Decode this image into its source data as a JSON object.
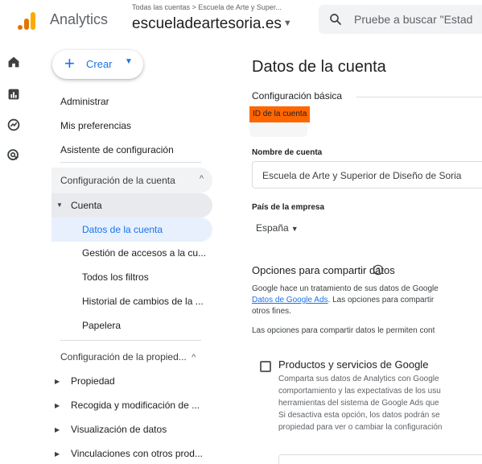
{
  "header": {
    "app_title": "Analytics",
    "breadcrumb": "Todas las cuentas > Escuela de Arte y Super...",
    "property": "escueladeartesoria.es",
    "search_placeholder": "Pruebe a buscar \"Estad"
  },
  "rail": {
    "icons": [
      "home-icon",
      "reports-icon",
      "explore-icon",
      "advertising-icon"
    ]
  },
  "sidebar": {
    "create_label": "Crear",
    "top_items": [
      "Administrar",
      "Mis preferencias",
      "Asistente de configuración"
    ],
    "account_section": {
      "title": "Configuración de la cuenta",
      "group": "Cuenta",
      "items": [
        "Datos de la cuenta",
        "Gestión de accesos a la cu...",
        "Todos los filtros",
        "Historial de cambios de la ...",
        "Papelera"
      ],
      "selected": "Datos de la cuenta"
    },
    "property_section": {
      "title": "Configuración de la propied...",
      "items": [
        "Propiedad",
        "Recogida y modificación de ...",
        "Visualización de datos",
        "Vinculaciones con otros prod..."
      ]
    }
  },
  "main": {
    "title": "Datos de la cuenta",
    "basic_config": "Configuración básica",
    "account_id_label": "ID de la cuenta",
    "account_name_label": "Nombre de cuenta",
    "account_name_value": "Escuela de Arte y Superior de Diseño de Soria",
    "country_label": "País de la empresa",
    "country_value": "España",
    "sharing_title": "Opciones para compartir datos",
    "sharing_para_line1": "Google hace un tratamiento de sus datos de Google",
    "sharing_para_link": "Datos de Google Ads",
    "sharing_para_line2_rest": ". Las opciones para compartir",
    "sharing_para_line3": "otros fines.",
    "sharing_para2": "Las opciones para compartir datos le permiten cont",
    "product_title": "Productos y servicios de Google",
    "product_desc": [
      "Comparta sus datos de Analytics con Google",
      "comportamiento y las expectativas de los usu",
      "herramientas del sistema de Google Ads que",
      "Si desactiva esta opción, los datos podrán se",
      "propiedad para ver o cambiar la configuración"
    ]
  },
  "colors": {
    "accent": "#1a73e8",
    "highlight": "#ff6600",
    "logo_orange": "#f9ab00",
    "logo_dark": "#e37400"
  }
}
